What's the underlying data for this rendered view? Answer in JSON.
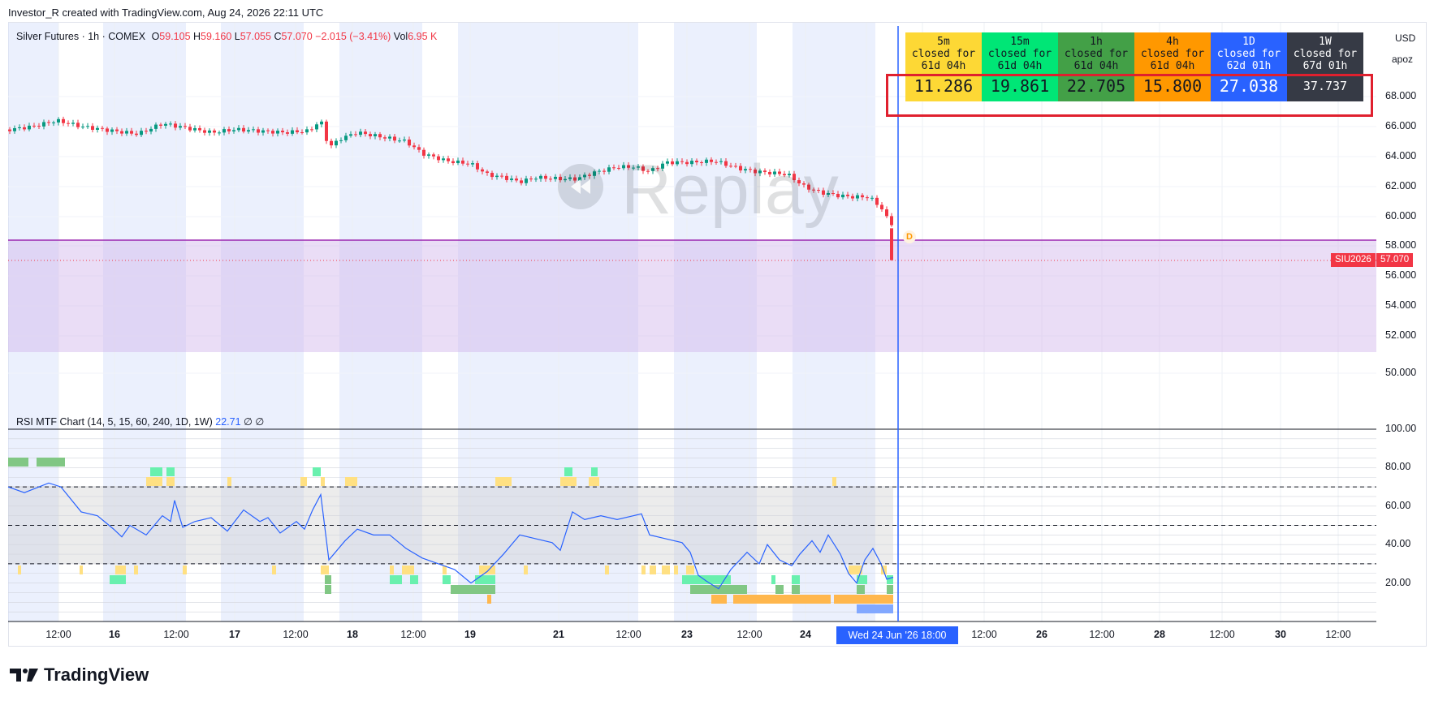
{
  "header": {
    "attribution": "Investor_R created with TradingView.com, Aug 24, 2026 22:11 UTC"
  },
  "legend": {
    "symbol": "Silver Futures · 1h · COMEX",
    "open_label": "O",
    "open": "59.105",
    "high_label": "H",
    "high": "59.160",
    "low_label": "L",
    "low": "57.055",
    "close_label": "C",
    "close": "57.070",
    "change": "−2.015 (−3.41%)",
    "vol_label": "Vol",
    "vol": "6.95 K"
  },
  "rsi_legend": {
    "title": "RSI MTF Chart (14, 5, 15, 60, 240, 1D, 1W)",
    "value": "22.71",
    "extra1": "∅",
    "extra2": "∅"
  },
  "price_axis": {
    "currency": "USD",
    "setting": "apoz",
    "labels": [
      "68.000",
      "66.000",
      "64.000",
      "62.000",
      "60.000",
      "58.000",
      "56.000",
      "54.000",
      "52.000",
      "50.000"
    ],
    "symbol_badge": "SIU2026",
    "last_price": "57.070"
  },
  "rsi_axis": {
    "labels": [
      "100.00",
      "80.00",
      "60.00",
      "40.00",
      "20.00"
    ]
  },
  "time_axis": {
    "labels": [
      {
        "t": "12:00",
        "bold": false
      },
      {
        "t": "16",
        "bold": true
      },
      {
        "t": "12:00",
        "bold": false
      },
      {
        "t": "17",
        "bold": true
      },
      {
        "t": "12:00",
        "bold": false
      },
      {
        "t": "18",
        "bold": true
      },
      {
        "t": "12:00",
        "bold": false
      },
      {
        "t": "19",
        "bold": true
      },
      {
        "t": "21",
        "bold": true
      },
      {
        "t": "12:00",
        "bold": false
      },
      {
        "t": "23",
        "bold": true
      },
      {
        "t": "12:00",
        "bold": false
      },
      {
        "t": "24",
        "bold": true
      },
      {
        "t": "12:00",
        "bold": false
      },
      {
        "t": "26",
        "bold": true
      },
      {
        "t": "12:00",
        "bold": false
      },
      {
        "t": "28",
        "bold": true
      },
      {
        "t": "12:00",
        "bold": false
      },
      {
        "t": "30",
        "bold": true
      },
      {
        "t": "12:00",
        "bold": false
      }
    ],
    "cursor_label": "Wed 24 Jun '26   18:00"
  },
  "mtf_table": [
    {
      "tf": "5m",
      "status": "closed for",
      "age": "61d 04h",
      "value": "11.286",
      "bg": "#fdd835",
      "fg": "#131722"
    },
    {
      "tf": "15m",
      "status": "closed for",
      "age": "61d 04h",
      "value": "19.861",
      "bg": "#00e676",
      "fg": "#131722"
    },
    {
      "tf": "1h",
      "status": "closed for",
      "age": "61d 04h",
      "value": "22.705",
      "bg": "#43a047",
      "fg": "#131722"
    },
    {
      "tf": "4h",
      "status": "closed for",
      "age": "61d 04h",
      "value": "15.800",
      "bg": "#ff9800",
      "fg": "#131722"
    },
    {
      "tf": "1D",
      "status": "closed for",
      "age": "62d 01h",
      "value": "27.038",
      "bg": "#2962ff",
      "fg": "#ffffff"
    },
    {
      "tf": "1W",
      "status": "closed for",
      "age": "67d 01h",
      "value": "37.737",
      "bg": "#363a45",
      "fg": "#ffffff"
    }
  ],
  "watermark": "Replay",
  "dividend_marker": "D",
  "brand": "TradingView",
  "colors": {
    "up": "#089981",
    "down": "#f23645",
    "rsi_line": "#2962ff",
    "zone": "#d1b3ea",
    "cursor": "#2962ff"
  }
}
